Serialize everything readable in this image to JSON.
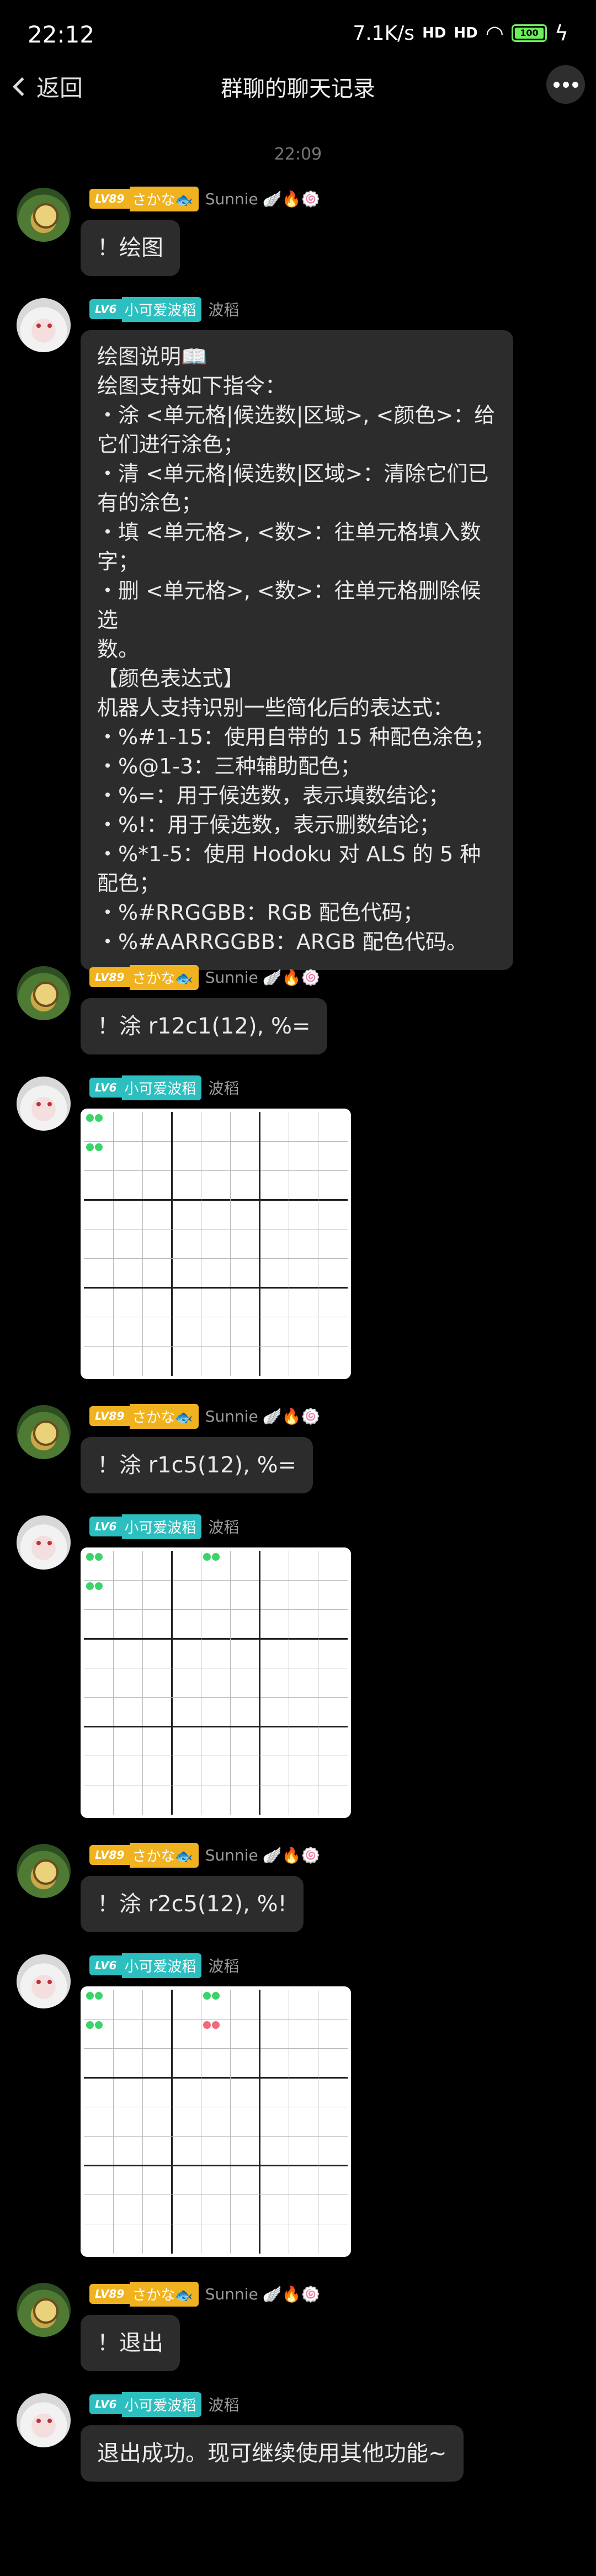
{
  "status_bar": {
    "time": "22:12",
    "net_speed": "7.1K/s",
    "signal_1": "HD",
    "signal_2": "HD",
    "battery": "100"
  },
  "header": {
    "back_label": "返回",
    "title": "群聊的聊天记录"
  },
  "timestamp": "22:09",
  "users": {
    "a": {
      "level": "LV89",
      "title": "さかな🐟",
      "nick": "Sunnie",
      "emojis": "🪽🔥🍥"
    },
    "b": {
      "level": "LV6",
      "title": "小可爱波稻",
      "nick": "波稻"
    }
  },
  "messages": [
    {
      "text": "！绘图"
    },
    {
      "lines": [
        "绘图说明📖",
        "绘图支持如下指令：",
        "・涂 <单元格|候选数|区域>, <颜色>：给",
        "它们进行涂色；",
        "・清 <单元格|候选数|区域>：清除它们已",
        "有的涂色；",
        "・填 <单元格>, <数>：往单元格填入数",
        "字；",
        "・删 <单元格>, <数>：往单元格删除候选",
        "数。",
        "【颜色表达式】",
        "机器人支持识别一些简化后的表达式：",
        "・%#1-15：使用自带的 15 种配色涂色；",
        "・%@1-3：三种辅助配色；",
        "・%=：用于候选数，表示填数结论；",
        "・%!：用于候选数，表示删数结论；",
        "・%*1-5：使用 Hodoku 对 ALS 的 5 种",
        "配色；",
        "・%#RRGGBB：RGB 配色代码；",
        "・%#AARRGGBB：ARGB 配色代码。"
      ]
    },
    {
      "text": "！涂 r12c1(12), %="
    },
    {
      "text": "！涂 r1c5(12), %="
    },
    {
      "text": "！涂 r2c5(12), %!"
    },
    {
      "text": "！退出"
    },
    {
      "text": "退出成功。现可继续使用其他功能~"
    }
  ],
  "colors": {
    "fill_conclusion": "#3bd46a",
    "remove_conclusion": "#f06a7a"
  }
}
